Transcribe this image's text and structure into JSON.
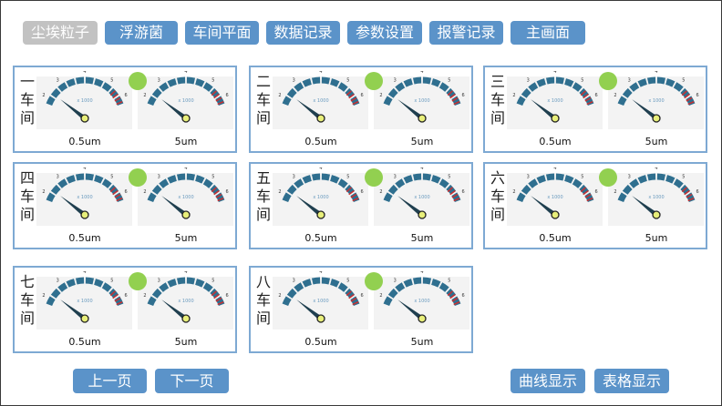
{
  "nav": {
    "items": [
      {
        "label": "尘埃粒子",
        "active": true
      },
      {
        "label": "浮游菌",
        "active": false
      },
      {
        "label": "车间平面",
        "active": false
      },
      {
        "label": "数据记录",
        "active": false
      },
      {
        "label": "参数设置",
        "active": false
      },
      {
        "label": "报警记录",
        "active": false
      },
      {
        "label": "主画面",
        "active": false
      }
    ]
  },
  "gauge_common": {
    "scale_labels": [
      "2",
      "3",
      "4",
      "5",
      "6"
    ],
    "multiplier_text": "x 1000",
    "ranges": [
      "0.5um",
      "5um"
    ]
  },
  "workshops": [
    {
      "name": "一车间",
      "status_color": "#92d050"
    },
    {
      "name": "二车间",
      "status_color": "#92d050"
    },
    {
      "name": "三车间",
      "status_color": "#92d050"
    },
    {
      "name": "四车间",
      "status_color": "#92d050"
    },
    {
      "name": "五车间",
      "status_color": "#92d050"
    },
    {
      "name": "六车间",
      "status_color": "#92d050"
    },
    {
      "name": "七车间",
      "status_color": "#92d050"
    },
    {
      "name": "八车间",
      "status_color": "#92d050"
    }
  ],
  "pager": {
    "prev": "上一页",
    "next": "下一页"
  },
  "views": {
    "curve": "曲线显示",
    "table": "表格显示"
  },
  "colors": {
    "button": "#5b93c9",
    "button_active": "#c2c2c2",
    "panel_border": "#7ea9d3",
    "gauge_arc": "#2f6f8f",
    "alarm_tick": "#d22b2b"
  }
}
